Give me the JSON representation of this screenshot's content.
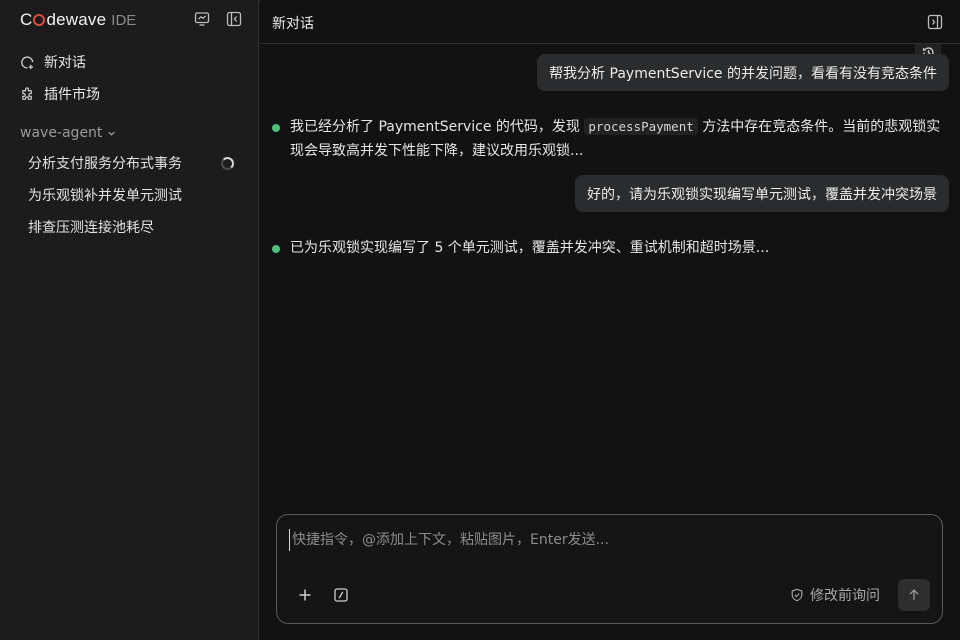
{
  "brand": {
    "name_prefix": "C",
    "name_suffix": "dewave",
    "product": "IDE"
  },
  "sidebar": {
    "new_chat_label": "新对话",
    "plugins_label": "插件市场",
    "group_label": "wave-agent",
    "conversations": [
      {
        "title": "分析支付服务分布式事务",
        "status": "loading"
      },
      {
        "title": "为乐观锁补并发单元测试"
      },
      {
        "title": "排查压测连接池耗尽"
      }
    ]
  },
  "header": {
    "title": "新对话"
  },
  "messages": {
    "user_1": "帮我分析 PaymentService 的并发问题，看看有没有竞态条件",
    "assistant_1_before": "我已经分析了 PaymentService 的代码，发现 ",
    "assistant_1_code": "processPayment",
    "assistant_1_after": " 方法中存在竞态条件。当前的悲观锁实现会导致高并发下性能下降，建议改用乐观锁...",
    "user_2": "好的，请为乐观锁实现编写单元测试，覆盖并发冲突场景",
    "assistant_2": "已为乐观锁实现编写了 5 个单元测试，覆盖并发冲突、重试机制和超时场景..."
  },
  "composer": {
    "placeholder": "快捷指令，@添加上下文，粘贴图片，Enter发送...",
    "ask_before_edit_label": "修改前询问"
  },
  "colors": {
    "status_dot": "#4ec07a",
    "logo_accent": "#e04a3f",
    "bubble_bg": "#2a2c2e"
  }
}
